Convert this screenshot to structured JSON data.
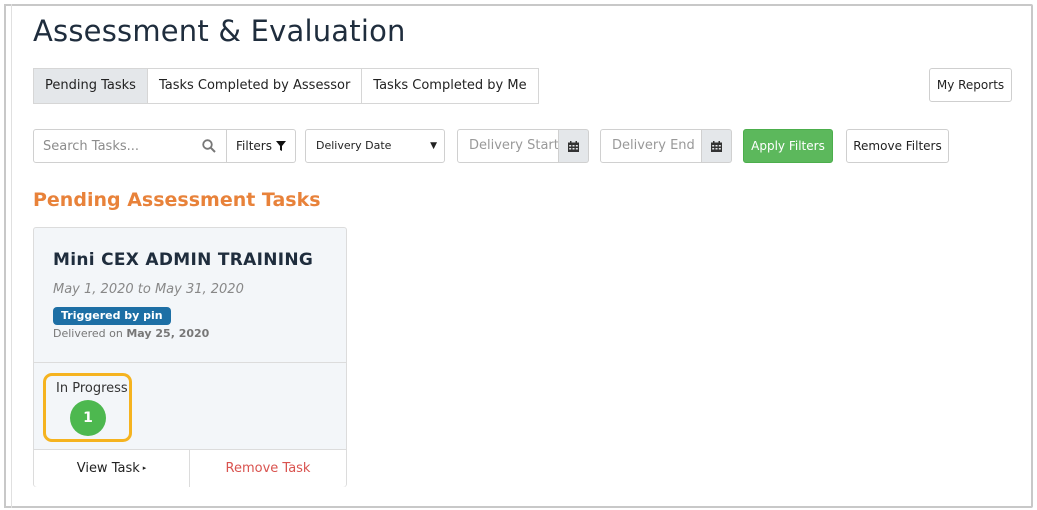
{
  "page": {
    "title": "Assessment & Evaluation"
  },
  "tabs": [
    {
      "label": "Pending Tasks",
      "active": true
    },
    {
      "label": "Tasks Completed by Assessor",
      "active": false
    },
    {
      "label": "Tasks Completed by Me",
      "active": false
    }
  ],
  "header": {
    "my_reports_label": "My Reports"
  },
  "filters": {
    "search_placeholder": "Search Tasks...",
    "filters_label": "Filters",
    "date_type_selected": "Delivery Date",
    "delivery_start_placeholder": "Delivery Start",
    "delivery_end_placeholder": "Delivery End",
    "apply_label": "Apply Filters",
    "remove_label": "Remove Filters"
  },
  "section": {
    "heading": "Pending Assessment Tasks"
  },
  "task": {
    "title": "Mini CEX ADMIN TRAINING",
    "dates": "May 1, 2020 to May 31, 2020",
    "badge": "Triggered by pin",
    "delivered_prefix": "Delivered on",
    "delivered_date": "May 25, 2020",
    "status_label": "In Progress",
    "status_count": "1",
    "view_label": "View Task",
    "remove_label": "Remove Task"
  },
  "colors": {
    "apply_button": "#5cb85c",
    "section_heading": "#e8823a",
    "badge": "#1d6fa5",
    "status_count": "#4db84f",
    "highlight": "#f5b31f",
    "remove_task": "#d9534f"
  }
}
